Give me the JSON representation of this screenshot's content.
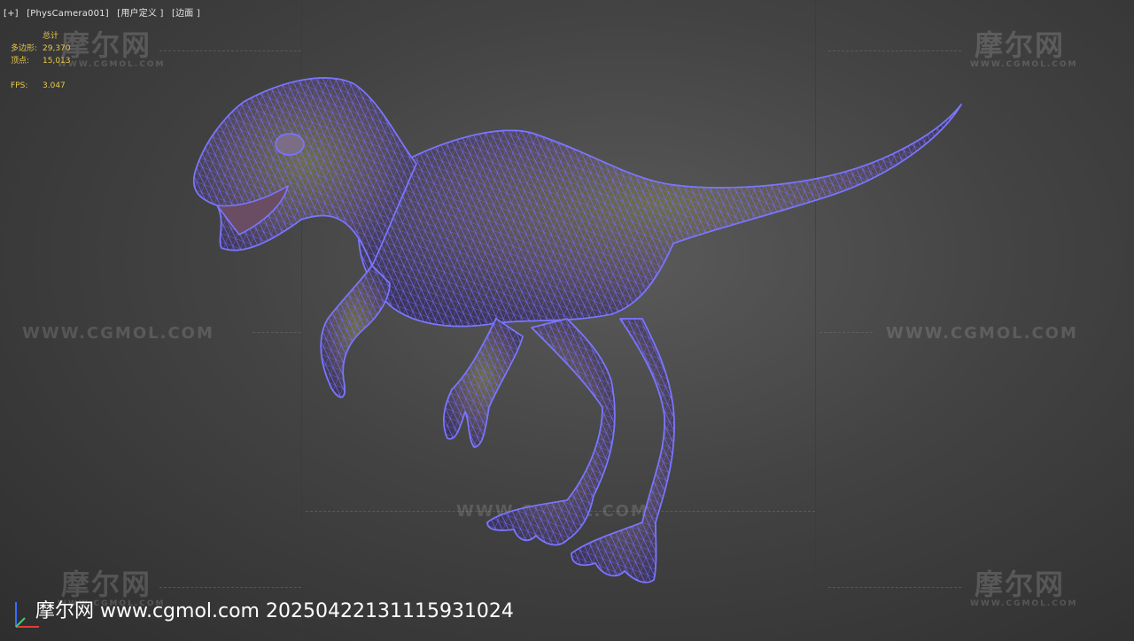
{
  "viewport": {
    "labels": [
      "[+]",
      "[PhysCamera001]",
      "[用户定义 ]",
      "[边面 ]"
    ]
  },
  "stats": {
    "header": "总计",
    "polygons_label": "多边形:",
    "polygons_value": "29,370",
    "vertices_label": "顶点:",
    "vertices_value": "15,013",
    "fps_label": "FPS:",
    "fps_value": "3.047"
  },
  "watermarks": {
    "site_text": "WWW.CGMOL.COM",
    "logo_cn": "摩尔网",
    "logo_en": "WWW.CGMOL.COM",
    "footer": "摩尔网 www.cgmol.com 20250422131115931024"
  },
  "colors": {
    "wire": "#6f6cff",
    "skin": "#6b6a4e"
  },
  "icons": [
    "axis-gizmo-icon"
  ]
}
